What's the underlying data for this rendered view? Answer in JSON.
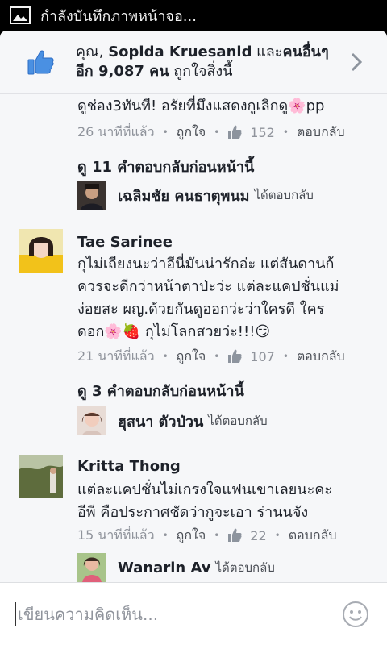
{
  "status_bar": {
    "notification_text": "กำลังบันทึกภาพหน้าจอ..."
  },
  "likes": {
    "prefix": "คุณ, ",
    "name": "Sopida Kruesanid",
    "middle": " และ",
    "others": "คนอื่นๆ",
    "line2_bold": "อีก 9,087 คน",
    "line2_rest": "ถูกใจสิ่งนี้"
  },
  "comments": [
    {
      "text": "ดูช่อง3ทันที! อรัยที่มึงแสดงกูเลิกดู🌸pp",
      "time": "26 นาทีที่แล้ว",
      "like_label": "ถูกใจ",
      "like_count": "152",
      "reply_label": "ตอบกลับ",
      "prev_replies": "ดู 11 คำตอบกลับก่อนหน้านี้",
      "last_reply_name": "เฉลิมชัย คนธาตุพนม",
      "last_reply_suffix": "ได้ตอบกลับ"
    },
    {
      "name": "Tae Sarinee",
      "lines": [
        "กุไม่เถียงนะว่าอีนี่มันน่ารักอ่ะ แต่สันดานก้",
        "ควรจะดีกว่าหน้าตาป่ะว่ะ แต่ละแคปชั่นแม่",
        "ง่อยสะ ผญ.ด้วยกันดูออกว่ะว่าใครดี ใคร",
        "ดอก🌸🍓 กุไม่โลกสวยว่ะ!!!😏"
      ],
      "time": "21 นาทีที่แล้ว",
      "like_label": "ถูกใจ",
      "like_count": "107",
      "reply_label": "ตอบกลับ",
      "prev_replies": "ดู 3 คำตอบกลับก่อนหน้านี้",
      "last_reply_name": "ฮุสนา ตัวป่วน",
      "last_reply_suffix": "ได้ตอบกลับ"
    },
    {
      "name": "Kritta Thong",
      "lines": [
        "แต่ละแคปชั่นไม่เกรงใจแฟนเขาเลยนะคะ",
        "อีพี คือประกาศชัดว่ากูจะเอา ร่านนจัง"
      ],
      "time": "15 นาทีที่แล้ว",
      "like_label": "ถูกใจ",
      "like_count": "22",
      "reply_label": "ตอบกลับ",
      "last_reply_name": "Wanarin Av",
      "last_reply_suffix": "ได้ตอบกลับ"
    }
  ],
  "composer": {
    "placeholder": "เขียนความคิดเห็น..."
  },
  "colors": {
    "facebook_blue": "#4267b2",
    "like_thumb": "#4080ff",
    "text_primary": "#1d2129",
    "text_secondary": "#90949c"
  }
}
